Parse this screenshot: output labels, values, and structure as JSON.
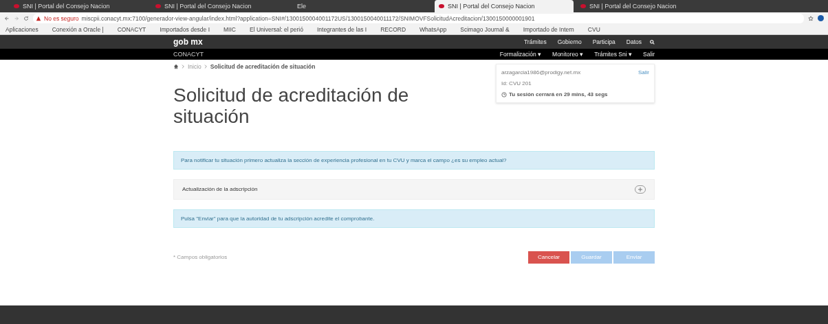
{
  "browser": {
    "tabs": [
      {
        "title": "SNI | Portal del Consejo Nacion",
        "selected": false,
        "favicon": true
      },
      {
        "title": "SNI | Portal del Consejo Nacion",
        "selected": false,
        "favicon": true
      },
      {
        "title": "Ele",
        "selected": false,
        "favicon": false
      },
      {
        "title": "SNI | Portal del Consejo Nacion",
        "selected": true,
        "favicon": true
      },
      {
        "title": "SNI | Portal del Consejo Nacion",
        "selected": false,
        "favicon": true
      }
    ],
    "security": "No es seguro",
    "url": "miscpii.conacyt.mx:7100/generador-view-angular/index.html?application=SNI#/1300150004001172US/1300150040011172/SNIMOVFSolicitudAcreditacion/1300150000001901",
    "bookmarks": [
      "Aplicaciones",
      "Conexión a Oracle |",
      "CONACYT",
      "Importados desde I",
      "MIIC",
      "El Universal: el perió",
      "Integrantes de las I",
      "RECORD",
      "WhatsApp",
      "Scimago Journal &",
      "Importado de Intern",
      "CVU"
    ]
  },
  "header": {
    "logo": "gob mx",
    "links": [
      "Trámites",
      "Gobierno",
      "Participa",
      "Datos"
    ],
    "org": "CONACYT",
    "menu": [
      "Formalización ▾",
      "Monitoreo ▾",
      "Trámites Sni ▾",
      "Salir"
    ]
  },
  "breadcrumb": {
    "parent": "Inicio",
    "current": "Solicitud de acreditación de situación"
  },
  "title": "Solicitud de acreditación de situación",
  "session": {
    "email": "arzagarcia1986@prodigy.net.mx",
    "logout": "Salir",
    "id": "Id: CVU 201",
    "timer": "Tu sesión cerrará en 29 mins, 43 segs"
  },
  "alerts": [
    "Para notificar tu situación primero actualiza la sección de experiencia profesional en tu CVU y marca el campo ¿es su empleo actual?",
    "Pulsa \"Enviar\" para que la autoridad de tu adscripción acredite el comprobante."
  ],
  "accordion": {
    "label": "Actualización de la adscripción",
    "expanded": false
  },
  "required_note": "* Campos obligatorios",
  "buttons": [
    {
      "label": "Cancelar",
      "kind": "danger"
    },
    {
      "label": "Guardar",
      "kind": "primary"
    },
    {
      "label": "Enviar",
      "kind": "primary"
    }
  ]
}
